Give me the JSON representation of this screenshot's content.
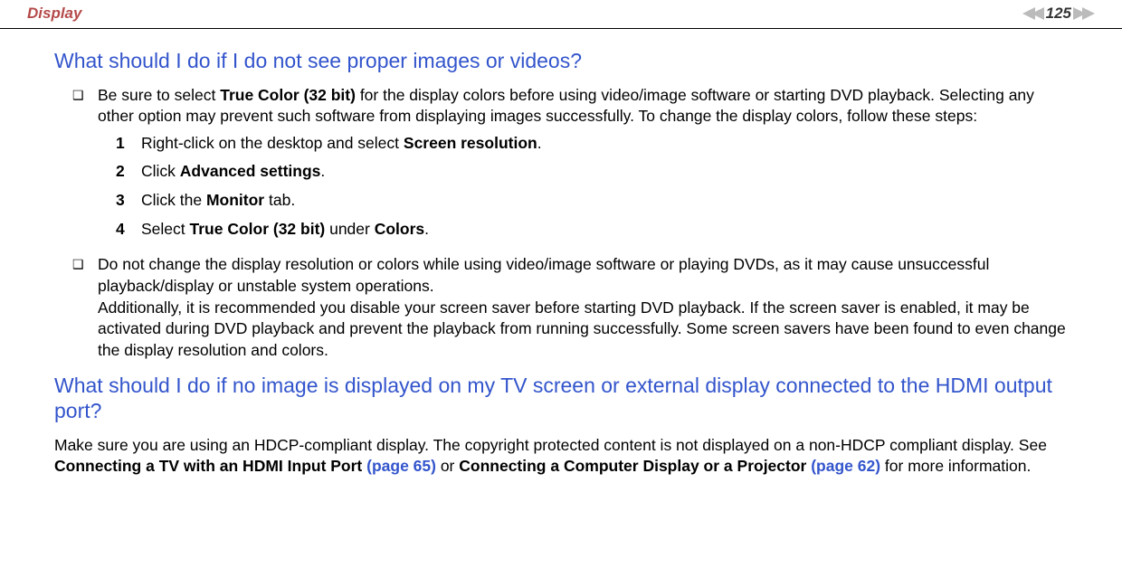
{
  "header": {
    "section": "Display",
    "page_number": "125"
  },
  "q1": {
    "heading": "What should I do if I do not see proper images or videos?",
    "bullet1_pre": "Be sure to select ",
    "bullet1_bold1": "True Color (32 bit)",
    "bullet1_post": " for the display colors before using video/image software or starting DVD playback. Selecting any other option may prevent such software from displaying images successfully. To change the display colors, follow these steps:",
    "steps": {
      "s1_pre": "Right-click on the desktop and select ",
      "s1_bold": "Screen resolution",
      "s1_post": ".",
      "s2_pre": "Click ",
      "s2_bold": "Advanced settings",
      "s2_post": ".",
      "s3_pre": "Click the ",
      "s3_bold": "Monitor",
      "s3_post": " tab.",
      "s4_pre": "Select ",
      "s4_bold1": "True Color (32 bit)",
      "s4_mid": " under ",
      "s4_bold2": "Colors",
      "s4_post": "."
    },
    "bullet2_p1": "Do not change the display resolution or colors while using video/image software or playing DVDs, as it may cause unsuccessful playback/display or unstable system operations.",
    "bullet2_p2": "Additionally, it is recommended you disable your screen saver before starting DVD playback. If the screen saver is enabled, it may be activated during DVD playback and prevent the playback from running successfully. Some screen savers have been found to even change the display resolution and colors."
  },
  "q2": {
    "heading": "What should I do if no image is displayed on my TV screen or external display connected to the HDMI output port?",
    "para_pre": "Make sure you are using an HDCP-compliant display. The copyright protected content is not displayed on a non-HDCP compliant display. See ",
    "para_bold1": "Connecting a TV with an HDMI Input Port ",
    "para_link1": "(page 65)",
    "para_mid": " or ",
    "para_bold2": "Connecting a Computer Display or a Projector ",
    "para_link2": "(page 62)",
    "para_post": " for more information."
  },
  "nums": {
    "n1": "1",
    "n2": "2",
    "n3": "3",
    "n4": "4"
  },
  "markers": {
    "square": "❑"
  }
}
